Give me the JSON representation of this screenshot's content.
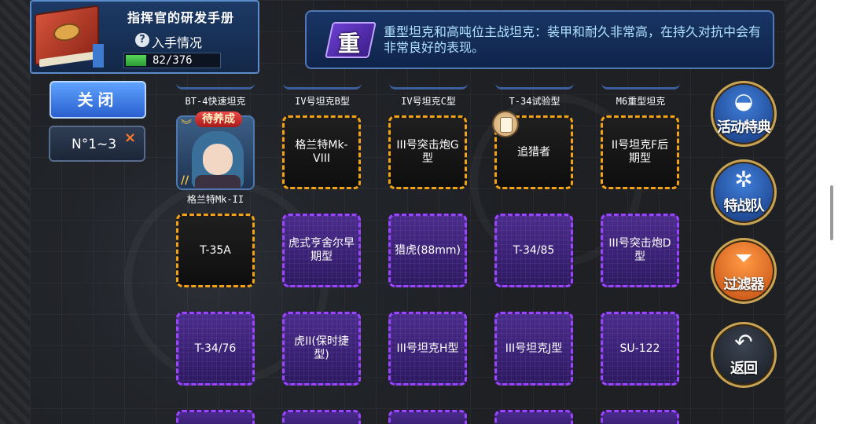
{
  "header": {
    "title": "指挥官的研发手册",
    "obtained_label": "入手情况",
    "help_symbol": "?",
    "progress_text": "82/376",
    "progress_fraction": 0.218
  },
  "info": {
    "badge": "重",
    "description": "重型坦克和高吨位主战坦克：装甲和耐久非常高，在持久对抗中会有非常良好的表现。"
  },
  "left": {
    "close_label": "关闭",
    "filter_label": "N°1~3",
    "filter_clear": "×"
  },
  "top_row": [
    "BT-4快速坦克",
    "IV号坦克B型",
    "IV号坦克C型",
    "T-34试验型",
    "M6重型坦克"
  ],
  "character": {
    "status_tag": "待养成",
    "name": "格兰特Mk-II",
    "rank_symbol": "//"
  },
  "cards": {
    "r1c2": "格兰特Mk-VIII",
    "r1c3": "III号突击炮G型",
    "r1c4": "追猎者",
    "r1c5": "II号坦克F后期型",
    "r2c1": "T-35A",
    "r2c2": "虎式亨舍尔早期型",
    "r2c3": "猎虎(88mm)",
    "r2c4": "T-34/85",
    "r2c5": "III号突击炮D型",
    "r3c1": "T-34/76",
    "r3c2": "虎II(保时捷型)",
    "r3c3": "III号坦克H型",
    "r3c4": "III号坦克J型",
    "r3c5": "SU-122"
  },
  "side_buttons": {
    "event": "活动特典",
    "squad": "特战队",
    "filter": "过滤器",
    "back": "返回"
  },
  "colors": {
    "gold_border": "#f2a216",
    "purple_border": "#9b45ff",
    "panel_blue": "#183566",
    "info_text": "#aee0ff"
  }
}
